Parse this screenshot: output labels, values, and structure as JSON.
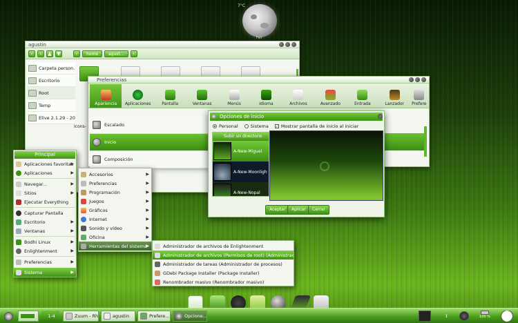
{
  "weather": {
    "temp": "7°C",
    "label": "Fair"
  },
  "file_manager": {
    "title": "agustin",
    "crumbs": [
      "home",
      "agust..."
    ],
    "side_items": [
      "Carpeta person...",
      "Escritorio",
      "Root",
      "Temp",
      "Elive 2.1.29 - 20"
    ],
    "partial_label": "Icons-"
  },
  "prefs": {
    "title": "Preferencias",
    "tabs": [
      "Apariencia",
      "Aplicaciones",
      "Pantalla",
      "Ventanas",
      "Menús",
      "Idioma",
      "Archivos",
      "Avanzado",
      "Entrada",
      "Lanzador",
      "Prefere"
    ],
    "list": [
      "Escalado",
      "Inicio",
      "Composición"
    ]
  },
  "startup_dialog": {
    "title": "Opciones de inicio",
    "radio_personal": "Personal",
    "radio_system": "Sistema",
    "show_splash": "Mostrar pantalla de inicio al iniciar",
    "up_dir": "Subir un directorio",
    "items": [
      "A-New-Miguel",
      "A-New-Moonligh",
      "A-New-Nopal"
    ],
    "buttons": [
      "Aceptar",
      "Aplicar",
      "Cerrar"
    ]
  },
  "main_menu": {
    "title": "Principal",
    "items": [
      "Aplicaciones favoritas",
      "Aplicaciones",
      "Navegar...",
      "Sitios",
      "Ejecutar Everything",
      "Capturar Pantalla",
      "Escritorio",
      "Ventanas",
      "Bodhi Linux",
      "Enlightenment",
      "Preferencias",
      "Sistema"
    ]
  },
  "apps_menu": {
    "items": [
      "Accesorios",
      "Preferencias",
      "Programación",
      "Juegos",
      "Gráficos",
      "Internet",
      "Sonido y vídeo",
      "Oficina",
      "Herramientas del sistema"
    ]
  },
  "tools_menu": {
    "items": [
      "Administrador de archivos de Enlightenment",
      "Administrador de archivos (Permisos de root) (Administrador de archivos)",
      "Administrador de tareas (Administrador de procesos)",
      "GDebi Package Installer (Package Installer)",
      "Renombrador masivo (Renombrador masivo)"
    ]
  },
  "taskbar": {
    "pager": "1-4",
    "tasks": [
      "Zuum - Rh...",
      "agustin",
      "Prefere...",
      "Opcione..."
    ],
    "battery": "100 %"
  }
}
